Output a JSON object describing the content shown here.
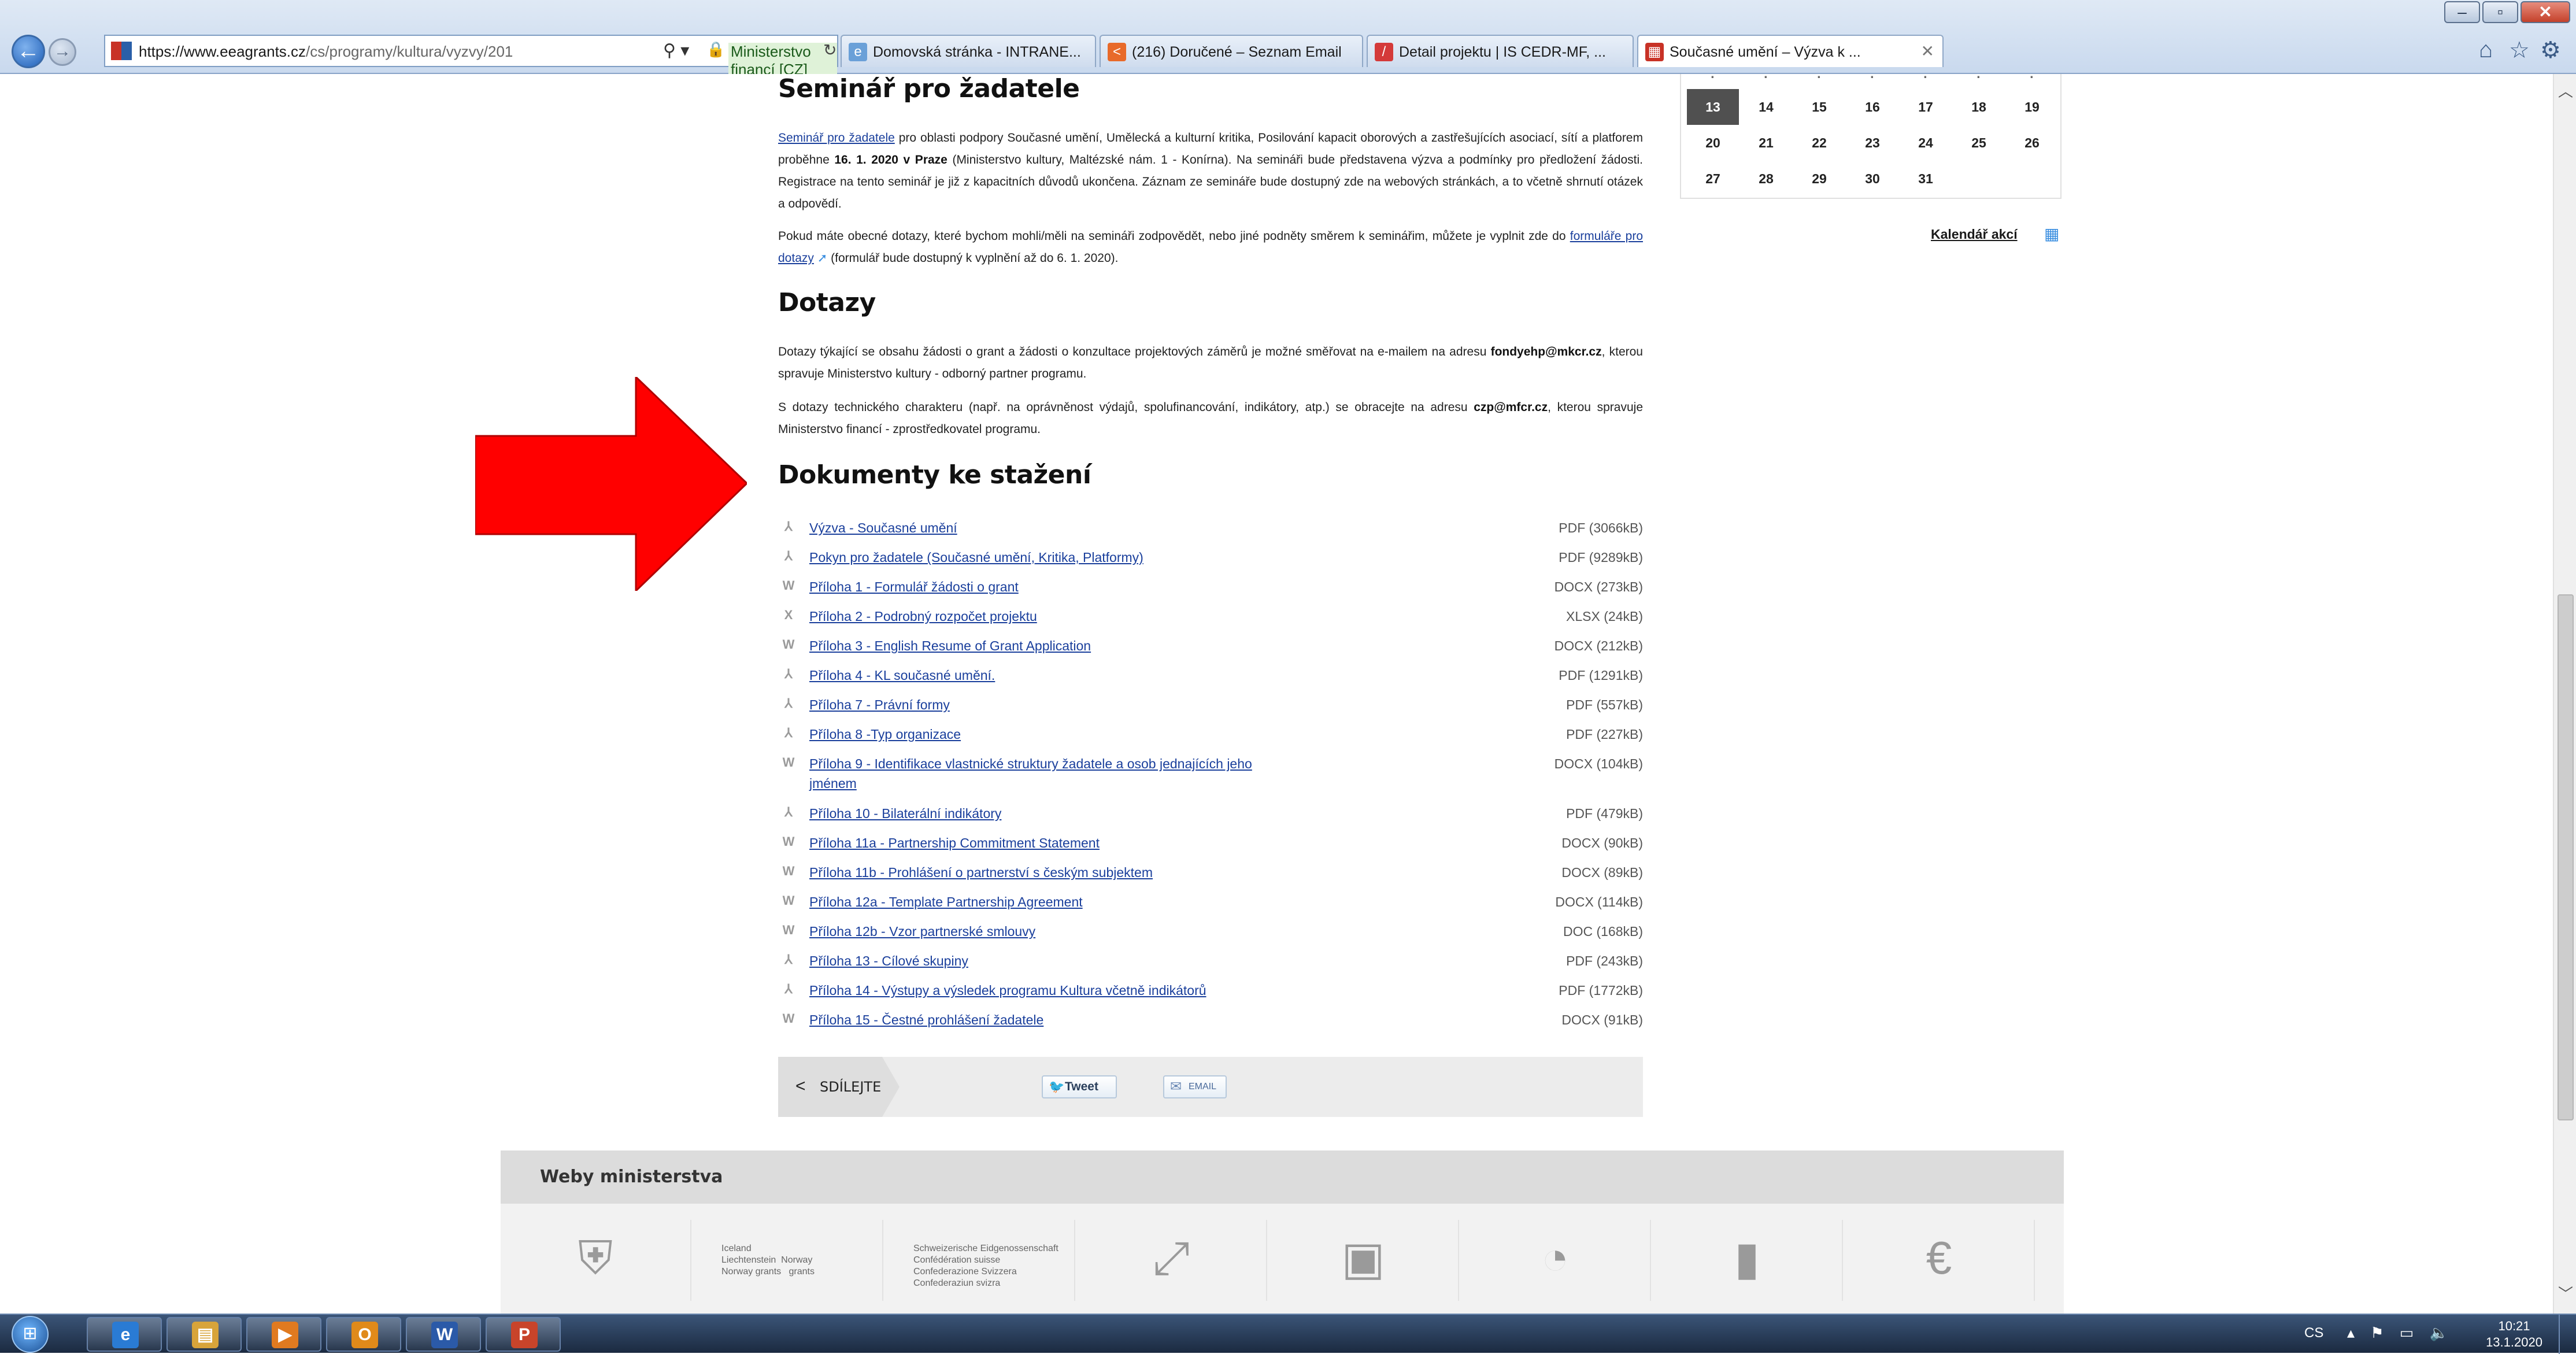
{
  "browser": {
    "address": {
      "url_host": "https://www.eeagrants.cz",
      "url_path": "/cs/programy/kultura/vyzvy/201",
      "search_icon": "⚲ ▾",
      "certificate": "Ministerstvo financí [CZ]"
    },
    "tabs": [
      {
        "label": "Domovská stránka - INTRANE...",
        "color": "#6aa0d8",
        "glyph": "e"
      },
      {
        "label": "(216) Doručené – Seznam Email",
        "color": "#e86a2a",
        "glyph": "<"
      },
      {
        "label": "Detail projektu | IS CEDR-MF, ...",
        "color": "#d43a3a",
        "glyph": "/"
      },
      {
        "label": "Současné umění – Výzva k ...",
        "color": "#c83226",
        "glyph": "▦"
      }
    ],
    "icons": {
      "back": "back-arrow-icon",
      "forward": "forward-arrow-icon",
      "home": "home-icon",
      "favorites": "star-icon",
      "tools": "gear-icon"
    }
  },
  "page": {
    "seminar": {
      "heading": "Seminář pro žadatele",
      "link_text": "Seminář pro žadatele",
      "text_1": " pro oblasti podpory Současné umění, Umělecká a kulturní kritika, Posilování kapacit oborových a zastřešujících asociací, sítí a platforem proběhne ",
      "date_bold": "16. 1. 2020 v Praze",
      "text_2": " (Ministerstvo kultury, Maltézské nám. 1 - Konírna). Na semináři bude představena výzva a podmínky pro předložení žádosti. Registrace na tento seminář je již z kapacitních důvodů ukončena. Záznam ze semináře bude dostupný zde na webových stránkách, a to včetně shrnutí otázek a odpovědí.",
      "para2_text_1": "Pokud máte obecné dotazy, které bychom mohli/měli na semináři zodpovědět, nebo jiné podněty směrem k seminářim, můžete je vyplnit zde do ",
      "para2_link": "formuláře pro dotazy",
      "para2_text_2": " (formulář bude dostupný k vyplnění až do 6. 1. 2020)."
    },
    "dotazy": {
      "heading": "Dotazy",
      "p1_text_1": "Dotazy týkající se obsahu žádosti o grant a žádosti o konzultace projektových záměrů je možné směřovat na e-mailem na adresu ",
      "p1_email": "fondyehp@mkcr.cz",
      "p1_text_2": ", kterou spravuje Ministerstvo kultury - odborný partner programu.",
      "p2_text_1": "S dotazy technického charakteru (např. na oprávněnost výdajů, spolufinancování, indikátory, atp.) se obracejte na adresu ",
      "p2_email": "czp@mfcr.cz",
      "p2_text_2": ", kterou spravuje Ministerstvo financí - zprostředkovatel programu."
    },
    "documents": {
      "heading": "Dokumenty ke stažení",
      "items": [
        {
          "name": "Výzva - Současné umění",
          "meta": "PDF (3066kB)",
          "icon": "pdf-icon"
        },
        {
          "name": "Pokyn pro žadatele (Současné umění, Kritika, Platformy)",
          "meta": "PDF (9289kB)",
          "icon": "pdf-icon"
        },
        {
          "name": "Příloha 1 - Formulář žádosti o grant",
          "meta": "DOCX (273kB)",
          "icon": "word-icon"
        },
        {
          "name": "Příloha 2 - Podrobný rozpočet projektu",
          "meta": "XLSX (24kB)",
          "icon": "excel-icon"
        },
        {
          "name": "Příloha 3 - English Resume of Grant Application",
          "meta": "DOCX (212kB)",
          "icon": "word-icon"
        },
        {
          "name": "Příloha 4 - KL současné umění.",
          "meta": "PDF (1291kB)",
          "icon": "pdf-icon"
        },
        {
          "name": "Příloha 7 - Právní formy",
          "meta": "PDF (557kB)",
          "icon": "pdf-icon"
        },
        {
          "name": "Příloha 8 -Typ organizace",
          "meta": "PDF (227kB)",
          "icon": "pdf-icon"
        },
        {
          "name": "Příloha 9 - Identifikace vlastnické struktury žadatele a osob jednajících jeho",
          "name2": "jménem",
          "meta": "DOCX (104kB)",
          "icon": "word-icon"
        },
        {
          "name": "Příloha 10 - Bilaterální indikátory",
          "meta": "PDF (479kB)",
          "icon": "pdf-icon"
        },
        {
          "name": "Příloha 11a - Partnership Commitment Statement",
          "meta": "DOCX (90kB)",
          "icon": "word-icon"
        },
        {
          "name": "Příloha 11b - Prohlášení o partnerství s českým subjektem",
          "meta": "DOCX (89kB)",
          "icon": "word-icon"
        },
        {
          "name": "Příloha 12a - Template Partnership Agreement",
          "meta": "DOCX (114kB)",
          "icon": "word-icon"
        },
        {
          "name": "Příloha 12b - Vzor partnerské smlouvy",
          "meta": "DOC (168kB)",
          "icon": "word-icon"
        },
        {
          "name": "Příloha 13 - Cílové skupiny",
          "meta": "PDF (243kB)",
          "icon": "pdf-icon"
        },
        {
          "name": "Příloha 14 - Výstupy a výsledek programu Kultura včetně indikátorů",
          "meta": "PDF (1772kB)",
          "icon": "pdf-icon"
        },
        {
          "name": "Příloha 15 - Čestné prohlášení žadatele",
          "meta": "DOCX (91kB)",
          "icon": "word-icon"
        }
      ]
    },
    "share": {
      "label": "SDÍLEJTE",
      "tweet": "Tweet",
      "email": "EMAIL"
    },
    "calendar": {
      "rows": [
        [
          "13",
          "14",
          "15",
          "16",
          "17",
          "18",
          "19"
        ],
        [
          "20",
          "21",
          "22",
          "23",
          "24",
          "25",
          "26"
        ],
        [
          "27",
          "28",
          "29",
          "30",
          "31",
          "",
          ""
        ]
      ],
      "today": "13",
      "link": "Kalendář akcí"
    },
    "footer": {
      "title": "Weby ministerstva",
      "logos": [
        {
          "icon": "coat-of-arms-icon",
          "text": ""
        },
        {
          "icon": "eea-norway-grants-logo",
          "text": "Iceland\nLiechtenstein  Norway\nNorway grants   grants"
        },
        {
          "icon": "swiss-contribution-logo",
          "text": "Schweizerische Eidgenossenschaft\nConfédération suisse\nConfederazione Svizzera\nConfederaziun svizra"
        },
        {
          "icon": "arrows-icon",
          "text": ""
        },
        {
          "icon": "safe-icon",
          "text": ""
        },
        {
          "icon": "pie-chart-icon",
          "text": ""
        },
        {
          "icon": "building-icon",
          "text": ""
        },
        {
          "icon": "euro-icon",
          "text": ""
        }
      ]
    },
    "annotation": {
      "arrow_color": "#ff0000"
    }
  },
  "taskbar": {
    "apps": [
      {
        "icon": "internet-explorer-icon",
        "glyph": "e",
        "color": "#2a7bd4"
      },
      {
        "icon": "file-explorer-icon",
        "glyph": "▤",
        "color": "#d8a43a"
      },
      {
        "icon": "media-player-icon",
        "glyph": "▶",
        "color": "#e07a20"
      },
      {
        "icon": "outlook-icon",
        "glyph": "O",
        "color": "#e08a1a"
      },
      {
        "icon": "word-icon",
        "glyph": "W",
        "color": "#2b5aa8"
      },
      {
        "icon": "powerpoint-icon",
        "glyph": "P",
        "color": "#c8442a"
      }
    ],
    "lang": "CS",
    "time": "10:21",
    "date": "13.1.2020"
  }
}
